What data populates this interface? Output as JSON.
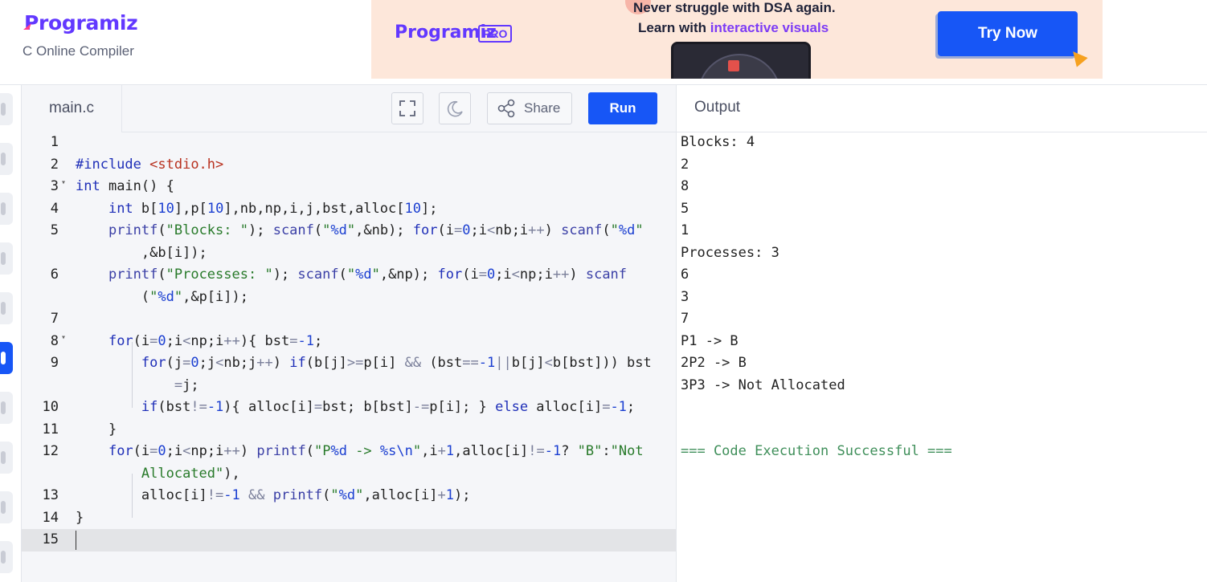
{
  "brand": {
    "name": "Programiz",
    "subtitle": "C Online Compiler"
  },
  "ad": {
    "logo": "Programiz",
    "pro_badge": "PRO",
    "line1": "Never struggle with DSA again.",
    "line2_prefix": "Learn with ",
    "line2_accent": "interactive visuals",
    "cta": "Try Now"
  },
  "editor": {
    "file_tab": "main.c",
    "share_label": "Share",
    "run_label": "Run"
  },
  "code_lines": [
    {
      "n": "1",
      "text": ""
    },
    {
      "n": "2",
      "text": "#include <stdio.h>"
    },
    {
      "n": "3",
      "text": "int main() {"
    },
    {
      "n": "4",
      "text": "    int b[10],p[10],nb,np,i,j,bst,alloc[10];"
    },
    {
      "n": "5",
      "text": "    printf(\"Blocks: \"); scanf(\"%d\",&nb); for(i=0;i<nb;i++) scanf(\"%d\"",
      "cont": "        ,&b[i]);"
    },
    {
      "n": "6",
      "text": "    printf(\"Processes: \"); scanf(\"%d\",&np); for(i=0;i<np;i++) scanf",
      "cont": "        (\"%d\",&p[i]);"
    },
    {
      "n": "7",
      "text": ""
    },
    {
      "n": "8",
      "text": "    for(i=0;i<np;i++){ bst=-1;"
    },
    {
      "n": "9",
      "text": "        for(j=0;j<nb;j++) if(b[j]>=p[i] && (bst==-1||b[j]<b[bst])) bst",
      "cont": "            =j;"
    },
    {
      "n": "10",
      "text": "        if(bst!=-1){ alloc[i]=bst; b[bst]-=p[i]; } else alloc[i]=-1;"
    },
    {
      "n": "11",
      "text": "    }"
    },
    {
      "n": "12",
      "text": "    for(i=0;i<np;i++) printf(\"P%d -> %s\\n\",i+1,alloc[i]!=-1? \"B\":\"Not",
      "cont": "        Allocated\"),"
    },
    {
      "n": "13",
      "text": "        alloc[i]!=-1 && printf(\"%d\",alloc[i]+1);"
    },
    {
      "n": "14",
      "text": "}"
    },
    {
      "n": "15",
      "text": ""
    }
  ],
  "output": {
    "title": "Output",
    "lines": [
      "Blocks: 4",
      "2",
      "8",
      "5",
      "1",
      "Processes: 3",
      "6",
      "3",
      "7",
      "P1 -> B",
      "2P2 -> B",
      "3P3 -> Not Allocated"
    ],
    "status": "=== Code Execution Successful ==="
  }
}
